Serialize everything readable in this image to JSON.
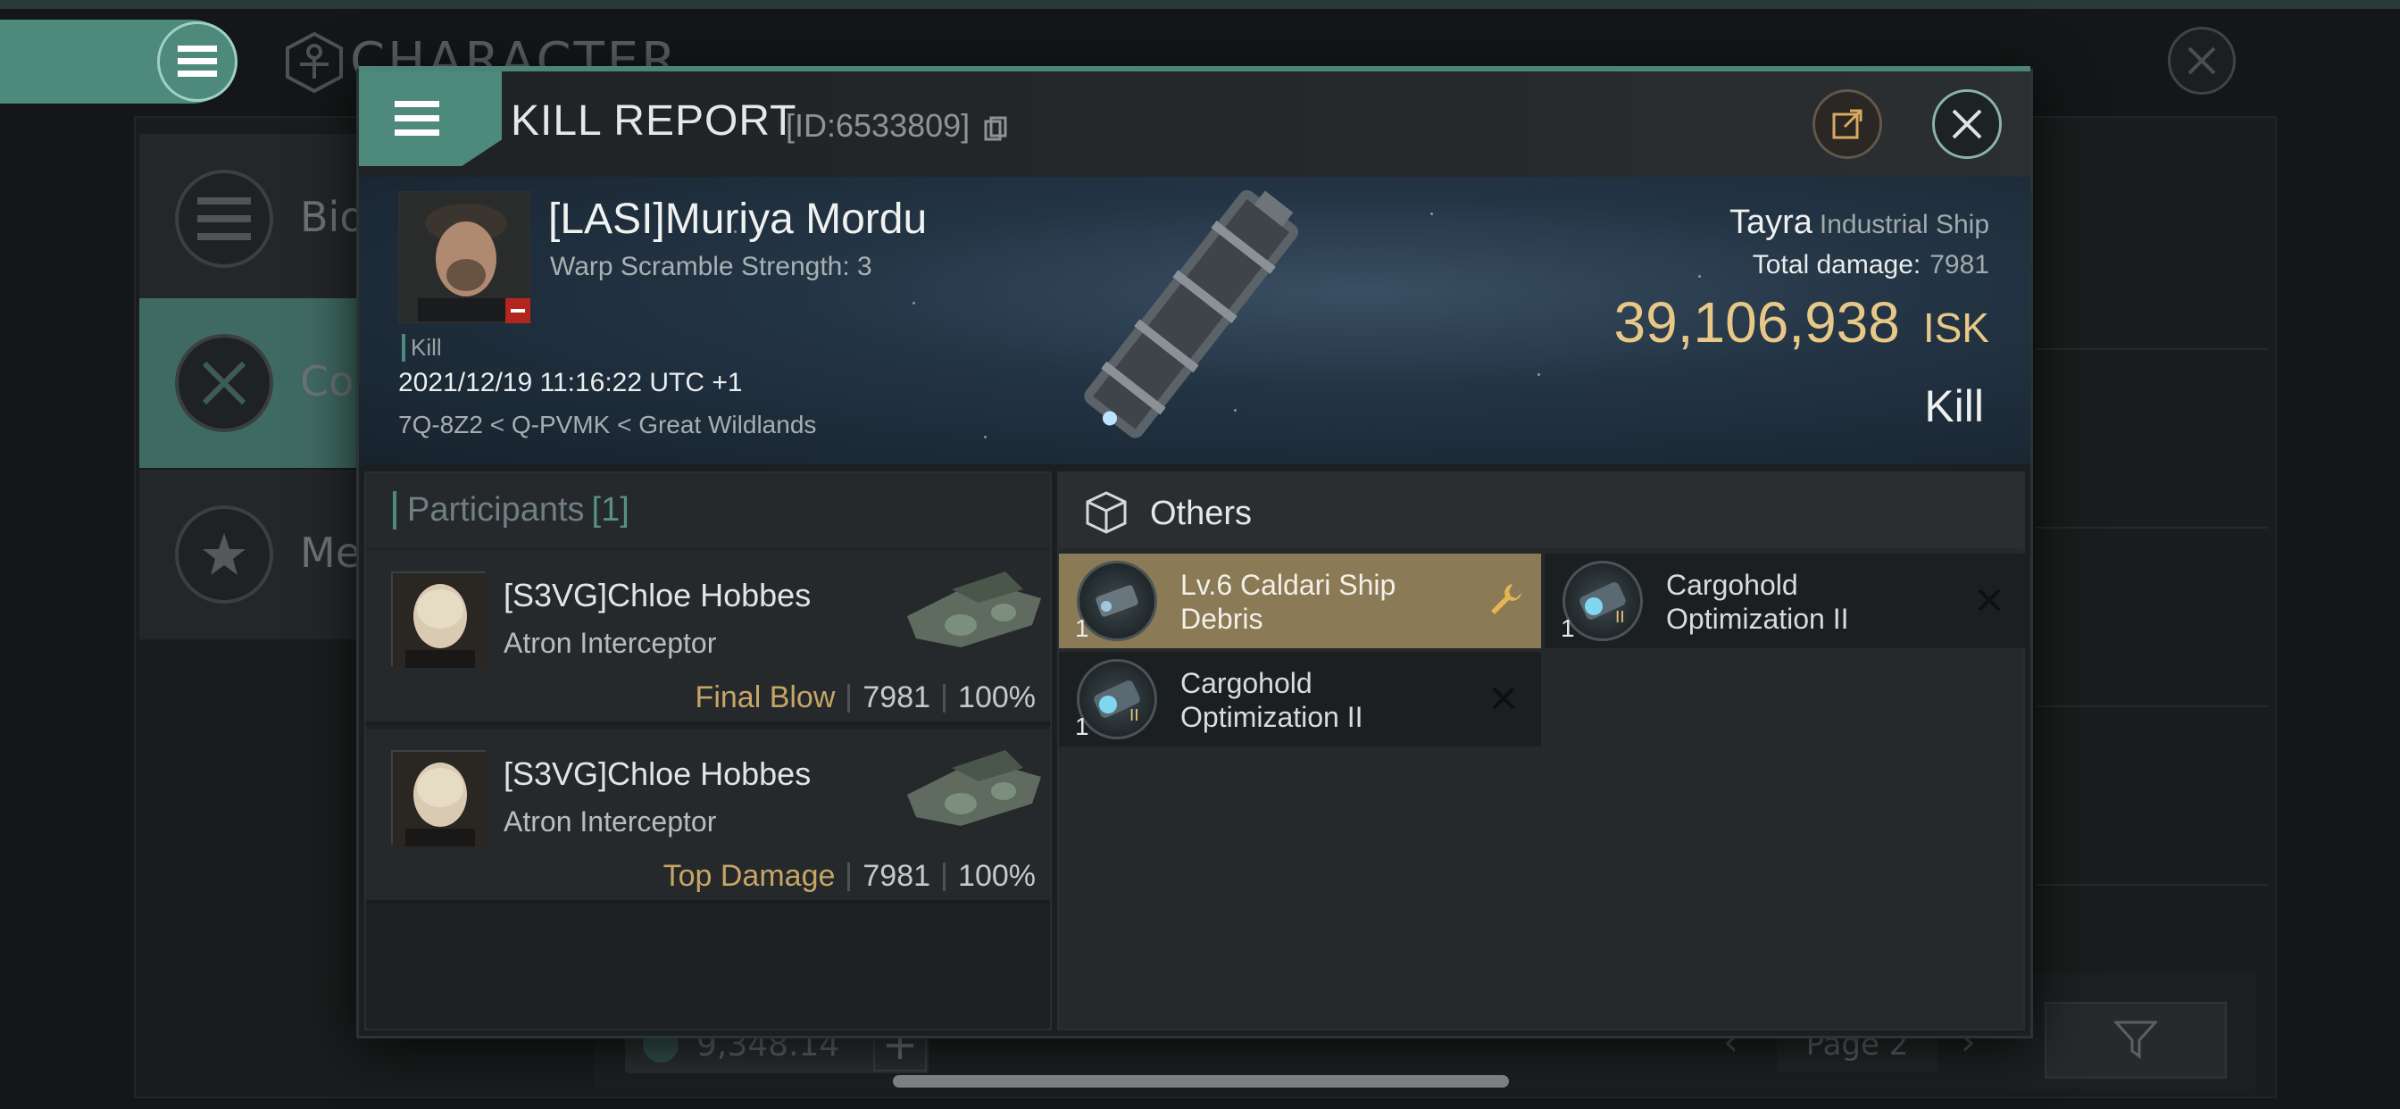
{
  "background": {
    "screen_title": "CHARACTER",
    "side_items": [
      {
        "label": "Bio",
        "icon": "list-icon"
      },
      {
        "label": "Cor",
        "icon": "crossed-swords-icon"
      },
      {
        "label": "Med",
        "icon": "star-badge-icon"
      }
    ],
    "wallet_value": "9,348.14",
    "page_label": "Page 2"
  },
  "dialog": {
    "title": "KILL REPORT",
    "id_label": "[ID:6533809]",
    "victim": {
      "name": "[LASI]Muriya Mordu",
      "subtitle": "Warp Scramble Strength: 3",
      "tag": "Kill",
      "timestamp": "2021/12/19 11:16:22 UTC +1",
      "location": "7Q-8Z2 < Q-PVMK < Great Wildlands"
    },
    "ship": {
      "name": "Tayra",
      "class": "Industrial Ship",
      "total_damage_label": "Total damage:",
      "total_damage_value": "7981",
      "isk_value": "39,106,938",
      "isk_unit": "ISK",
      "result": "Kill"
    },
    "participants": {
      "title": "Participants",
      "count": "[1]",
      "rows": [
        {
          "name": "[S3VG]Chloe Hobbes",
          "ship": "Atron Interceptor",
          "tag": "Final Blow",
          "damage": "7981",
          "percent": "100%"
        },
        {
          "name": "[S3VG]Chloe Hobbes",
          "ship": "Atron Interceptor",
          "tag": "Top Damage",
          "damage": "7981",
          "percent": "100%"
        }
      ]
    },
    "others": {
      "title": "Others",
      "items": [
        {
          "qty": "1",
          "label": "Lv.6 Caldari Ship Debris",
          "status": "dropped"
        },
        {
          "qty": "1",
          "label": "Cargohold Optimization II",
          "status": "destroyed"
        },
        {
          "qty": "1",
          "label": "Cargohold Optimization II",
          "status": "destroyed"
        }
      ]
    }
  },
  "colors": {
    "accent": "#4d8a7c",
    "isk_gold": "#e8c887",
    "highlight_item": "#8a7a56",
    "tag_gold": "#c6a567"
  }
}
